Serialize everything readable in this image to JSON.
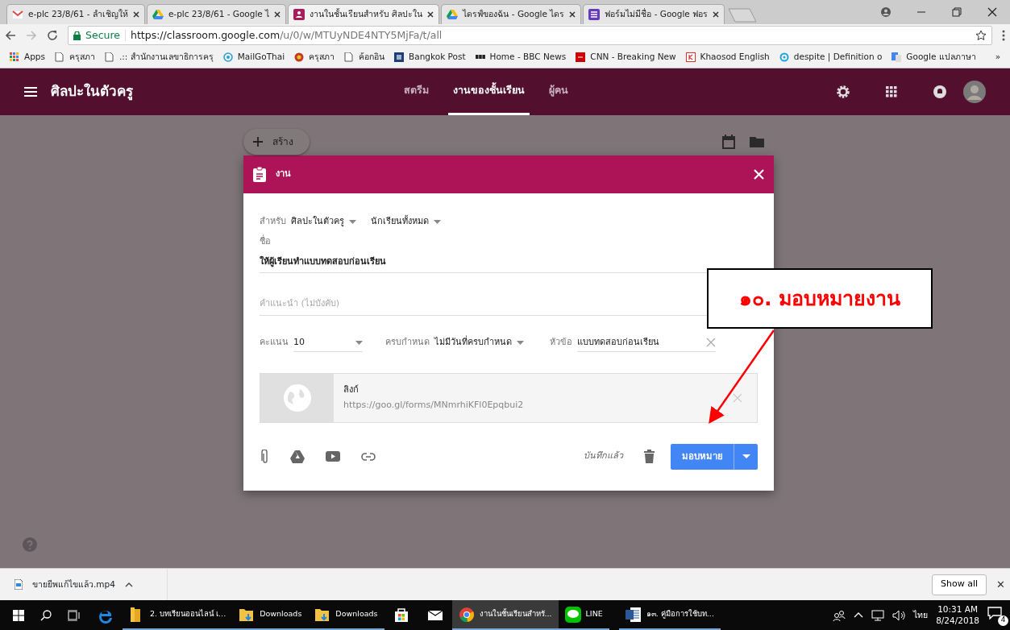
{
  "browser": {
    "tabs": [
      {
        "kind": "gmail",
        "title": "e-plc 23/8/61 - ลำเชิญให้",
        "selected": false
      },
      {
        "kind": "drive",
        "title": "e-plc 23/8/61 - Google ไ",
        "selected": false
      },
      {
        "kind": "classroom",
        "title": "งานในชั้นเรียนสำหรับ ศิลปะใน",
        "selected": true
      },
      {
        "kind": "drive",
        "title": "ไดรฟ์ของฉัน - Google ไดร",
        "selected": false
      },
      {
        "kind": "forms",
        "title": "ฟอร์มไม่มีชื่อ - Google ฟอร",
        "selected": false
      }
    ],
    "secure_label": "Secure",
    "url_host": "https://classroom.google.com",
    "url_path": "/u/0/w/MTUyNDE4NTY5MjFa/t/all",
    "bookmarks": [
      {
        "kind": "apps",
        "label": "Apps"
      },
      {
        "kind": "page",
        "label": "ครุสภา"
      },
      {
        "kind": "page",
        "label": ".:: สำนักงานเลขาธิการครุ"
      },
      {
        "kind": "at",
        "label": "MailGoThai"
      },
      {
        "kind": "emblem",
        "label": "ครุสภา"
      },
      {
        "kind": "page",
        "label": "ค้อกอิน"
      },
      {
        "kind": "bp",
        "label": "Bangkok Post"
      },
      {
        "kind": "bbc",
        "label": "Home - BBC News"
      },
      {
        "kind": "cnn",
        "label": "CNN - Breaking New"
      },
      {
        "kind": "k",
        "label": "Khaosod English"
      },
      {
        "kind": "ring",
        "label": "despite | Definition o"
      },
      {
        "kind": "translate",
        "label": "Google แปลภาษา"
      }
    ],
    "bookmarks_more": "»"
  },
  "app": {
    "title": "ศิลปะในตัวครู",
    "tabs": [
      {
        "label": "สตรีม",
        "selected": false
      },
      {
        "label": "งานของชั้นเรียน",
        "selected": true
      },
      {
        "label": "ผู้คน",
        "selected": false
      }
    ]
  },
  "create_button": "สร้าง",
  "dialog": {
    "title": "งาน",
    "for_label": "สำหรับ",
    "class_name": "ศิลปะในตัวครู",
    "students": "นักเรียนทั้งหมด",
    "title_label": "ชื่อ",
    "title_value": "ให้ผู้เรียนทำแบบทดสอบก่อนเรียน",
    "instructions_placeholder": "คำแนะนำ (ไม่บังคับ)",
    "points_label": "คะแนน",
    "points": "10",
    "due_label": "ครบกำหนด",
    "due": "ไม่มีวันที่ครบกำหนด",
    "topic_label": "หัวข้อ",
    "topic": "แบบทดสอบก่อนเรียน",
    "attachment": {
      "title": "ลิงก์",
      "url": "https://goo.gl/forms/MNmrhiKFl0Epqbui2"
    },
    "saved_status": "บันทึกแล้ว",
    "assign_button": "มอบหมาย"
  },
  "annotation": "๑๐. มอบหมายงาน",
  "download_bar": {
    "file": "ขายยีพแก้ไขแล้ว.mp4",
    "show_all": "Show all",
    "close": "✕"
  },
  "taskbar": {
    "items": [
      {
        "kind": "folder",
        "label": "2. บทเรียนออนไลน์ เ...",
        "selected": false
      },
      {
        "kind": "downloads",
        "label": "Downloads",
        "selected": false
      },
      {
        "kind": "downloads",
        "label": "Downloads",
        "selected": false
      },
      {
        "kind": "store",
        "selected": false
      },
      {
        "kind": "mail",
        "selected": false
      },
      {
        "kind": "chrome",
        "label": "งานในชั้นเรียนสำหรั...",
        "selected": true
      },
      {
        "kind": "line",
        "label": "LINE",
        "selected": false
      },
      {
        "kind": "word",
        "label": "๑๓. คู่มือการใช้บท...",
        "selected": false
      }
    ],
    "language": "ไทย",
    "time": "10:31 AM",
    "date": "8/24/2018",
    "notifications": "4"
  }
}
